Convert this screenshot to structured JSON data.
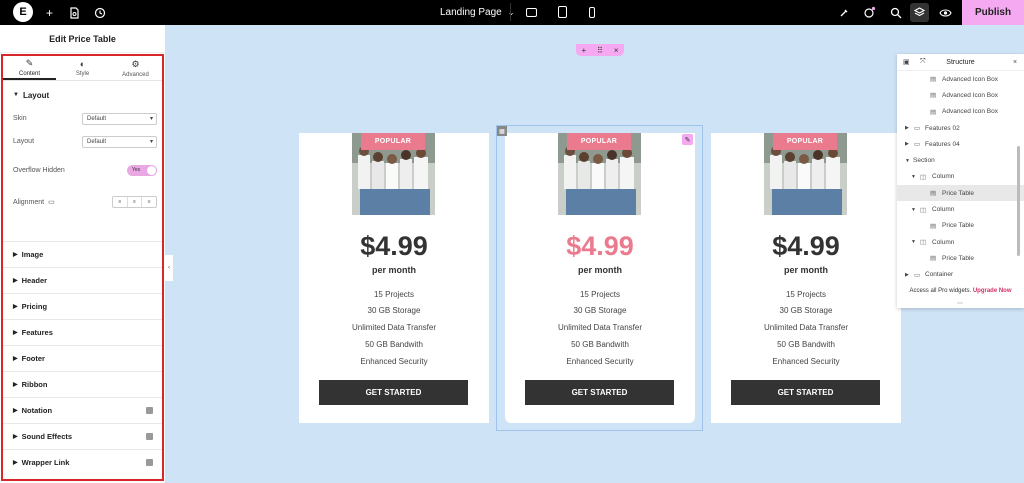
{
  "topbar": {
    "logo": "E",
    "page_title": "Landing Page",
    "publish_label": "Publish",
    "icons": [
      "plus-icon",
      "page-settings-icon",
      "history-icon",
      "chevron-down-icon",
      "desktop-icon",
      "tablet-icon",
      "mobile-icon",
      "ai-icon",
      "apps-icon",
      "search-icon",
      "structure-icon",
      "preview-icon"
    ]
  },
  "panel": {
    "title": "Edit Price Table",
    "tabs": [
      {
        "label": "Content",
        "icon": "pencil-icon",
        "glyph": "✎"
      },
      {
        "label": "Style",
        "icon": "half-circle-icon",
        "glyph": "◐"
      },
      {
        "label": "Advanced",
        "icon": "gear-icon",
        "glyph": "⚙"
      }
    ],
    "layout_section": "Layout",
    "skin_label": "Skin",
    "skin_value": "Default",
    "layout_label": "Layout",
    "layout_value": "Default",
    "overflow_label": "Overflow Hidden",
    "overflow_value": "Yes",
    "alignment_label": "Alignment",
    "sections": [
      {
        "label": "Image",
        "pro": false
      },
      {
        "label": "Header",
        "pro": false
      },
      {
        "label": "Pricing",
        "pro": false
      },
      {
        "label": "Features",
        "pro": false
      },
      {
        "label": "Footer",
        "pro": false
      },
      {
        "label": "Ribbon",
        "pro": false
      },
      {
        "label": "Notation",
        "pro": true
      },
      {
        "label": "Sound Effects",
        "pro": true
      },
      {
        "label": "Wrapper Link",
        "pro": true
      }
    ]
  },
  "cards": [
    {
      "ribbon": "POPULAR",
      "price": "$4.99",
      "price_color": "#333333",
      "period": "per month",
      "features": [
        "15 Projects",
        "30 GB Storage",
        "Unlimited Data Transfer",
        "50 GB Bandwith",
        "Enhanced Security"
      ],
      "button": "GET STARTED"
    },
    {
      "ribbon": "POPULAR",
      "price": "$4.99",
      "price_color": "#ea7b8f",
      "period": "per month",
      "features": [
        "15 Projects",
        "30 GB Storage",
        "Unlimited Data Transfer",
        "50 GB Bandwith",
        "Enhanced Security"
      ],
      "button": "GET STARTED"
    },
    {
      "ribbon": "POPULAR",
      "price": "$4.99",
      "price_color": "#333333",
      "period": "per month",
      "features": [
        "15 Projects",
        "30 GB Storage",
        "Unlimited Data Transfer",
        "50 GB Bandwith",
        "Enhanced Security"
      ],
      "button": "GET STARTED"
    }
  ],
  "structure": {
    "title": "Structure",
    "rows": [
      {
        "label": "Advanced Icon Box",
        "level": 2,
        "caret": false,
        "icon": "widget-icon",
        "highlight": false
      },
      {
        "label": "Advanced Icon Box",
        "level": 2,
        "caret": false,
        "icon": "widget-icon",
        "highlight": false
      },
      {
        "label": "Advanced Icon Box",
        "level": 2,
        "caret": false,
        "icon": "widget-icon",
        "highlight": false
      },
      {
        "label": "Features 02",
        "level": 0,
        "caret": true,
        "icon": "container-icon",
        "highlight": false
      },
      {
        "label": "Features 04",
        "level": 0,
        "caret": true,
        "icon": "container-icon",
        "highlight": false
      },
      {
        "label": "Section",
        "level": 0,
        "caret": true,
        "icon": "",
        "highlight": false
      },
      {
        "label": "Column",
        "level": 1,
        "caret": true,
        "icon": "column-icon",
        "highlight": false
      },
      {
        "label": "Price Table",
        "level": 2,
        "caret": false,
        "icon": "widget-icon",
        "highlight": true
      },
      {
        "label": "Column",
        "level": 1,
        "caret": true,
        "icon": "column-icon",
        "highlight": false
      },
      {
        "label": "Price Table",
        "level": 2,
        "caret": false,
        "icon": "widget-icon",
        "highlight": false
      },
      {
        "label": "Column",
        "level": 1,
        "caret": true,
        "icon": "column-icon",
        "highlight": false
      },
      {
        "label": "Price Table",
        "level": 2,
        "caret": false,
        "icon": "widget-icon",
        "highlight": false
      },
      {
        "label": "Container",
        "level": 0,
        "caret": true,
        "icon": "container-icon",
        "highlight": false
      }
    ],
    "footer_text": "Access all Pro widgets.",
    "footer_link": "Upgrade Now"
  },
  "colors": {
    "accent_pink": "#f4a9f0",
    "ribbon": "#ea7b8f",
    "highlight_border": "#d9262b",
    "canvas": "#cfe3f7"
  }
}
